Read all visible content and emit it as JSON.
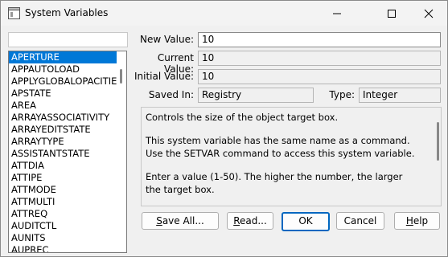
{
  "window": {
    "title": "System Variables"
  },
  "list": {
    "search_value": "",
    "items": [
      "APERTURE",
      "APPAUTOLOAD",
      "APPLYGLOBALOPACITIE",
      "APSTATE",
      "AREA",
      "ARRAYASSOCIATIVITY",
      "ARRAYEDITSTATE",
      "ARRAYTYPE",
      "ASSISTANTSTATE",
      "ATTDIA",
      "ATTIPE",
      "ATTMODE",
      "ATTMULTI",
      "ATTREQ",
      "AUDITCTL",
      "AUNITS",
      "AUPREC"
    ],
    "selected": "APERTURE"
  },
  "fields": {
    "new_value_label": "New Value:",
    "new_value": "10",
    "current_value_label": "Current Value:",
    "current_value": "10",
    "initial_value_label": "Initial Value:",
    "initial_value": "10",
    "saved_in_label": "Saved In:",
    "saved_in": "Registry",
    "type_label": "Type:",
    "type": "Integer"
  },
  "description": {
    "p1": "Controls the size of the object target box.",
    "p2": "This system variable has the same name as a command. Use the SETVAR command to access this system variable.",
    "p3": "Enter a value (1-50). The higher the number, the larger the target box."
  },
  "buttons": {
    "save_all": {
      "mnemonic": "S",
      "rest": "ave All..."
    },
    "read": {
      "mnemonic": "R",
      "rest": "ead..."
    },
    "ok": "OK",
    "cancel": "Cancel",
    "help": {
      "mnemonic": "H",
      "rest": "elp"
    }
  }
}
